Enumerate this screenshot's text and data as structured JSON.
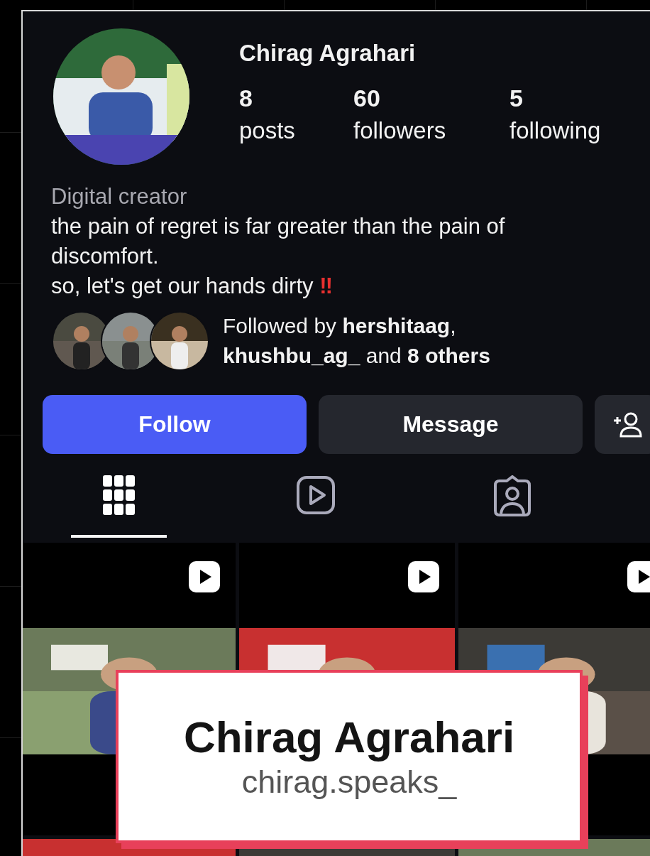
{
  "profile": {
    "name": "Chirag Agrahari",
    "avatar": {
      "kind": "picture"
    },
    "stats": [
      {
        "value": "8",
        "label": "posts"
      },
      {
        "value": "60",
        "label": "followers"
      },
      {
        "value": "5",
        "label": "following"
      }
    ],
    "category": "Digital creator",
    "bio": [
      "the pain of regret is far greater than the pain of discomfort.",
      "so, let's get our hands dirty"
    ],
    "bio_emoji": "‼",
    "followed_by": {
      "avatars": [
        {
          "kind": "picture"
        },
        {
          "kind": "picture"
        },
        {
          "kind": "picture"
        }
      ],
      "text": "Followed by **hershitaag**,\n**khushbu_ag_** and **8 others**"
    }
  },
  "buttons": [
    {
      "kind": "primary",
      "label": "Follow"
    },
    {
      "kind": "secondary",
      "label": "Message"
    },
    {
      "kind": "icon"
    }
  ],
  "tabs": [
    {
      "kind": "grid",
      "selected": true
    },
    {
      "kind": "reels",
      "selected": false
    },
    {
      "kind": "tagged",
      "selected": false
    }
  ],
  "posts": [
    {
      "kind": "reel"
    },
    {
      "kind": "reel"
    },
    {
      "kind": "reel"
    },
    {
      "kind": "picture"
    },
    {
      "kind": "picture"
    },
    {
      "kind": "picture"
    }
  ],
  "caption_card": {
    "title": "Chirag Agrahari",
    "handle": "chirag.speaks_"
  }
}
